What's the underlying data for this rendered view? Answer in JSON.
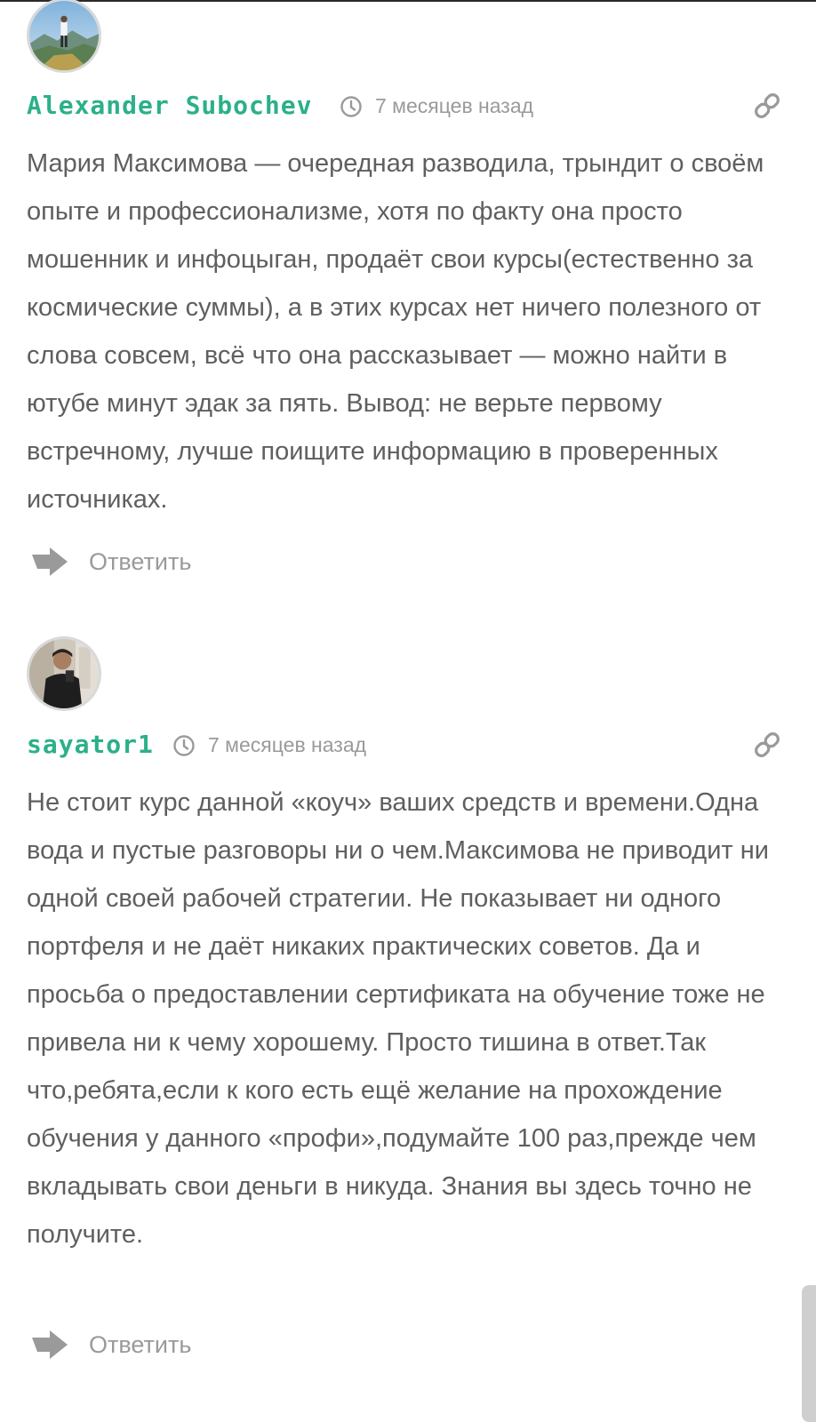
{
  "comments": [
    {
      "author": "Alexander Subochev",
      "time": "7 месяцев назад",
      "text": "Мария Максимова — очередная разводила, трындит о своём опыте и профессионализме, хотя по факту она просто мошенник и инфоцыган, продаёт свои курсы(естественно за космические суммы), а в этих курсах нет ничего полезного от слова совсем, всё что она рассказывает — можно найти в ютубе минут эдак за пять. Вывод: не верьте первому встречному, лучше поищите информацию в проверенных источниках.",
      "reply_label": "Ответить"
    },
    {
      "author": "sayator1",
      "time": "7 месяцев назад",
      "text": "Не стоит курс данной «коуч» ваших средств и времени.Одна вода и пустые разговоры ни о чем.Максимова не приводит ни одной своей рабочей стратегии. Не показывает ни одного портфеля и не даёт никаких практических советов. Да и просьба о предоставлении сертификата на обучение тоже не привела ни к чему хорошему. Просто тишина в ответ.Так что,ребята,если к кого есть ещё желание на прохождение обучения у данного «профи»,подумайте 100 раз,прежде чем вкладывать свои деньги в никуда. Знания вы здесь точно не получите.",
      "reply_label": "Ответить"
    }
  ],
  "colors": {
    "author": "#2bb08a",
    "meta": "#9a9a9a",
    "text": "#5f5f5f",
    "avatar_border": "#d9d9d9"
  },
  "icons": {
    "time": "clock-icon",
    "permalink": "link-icon",
    "reply": "reply-arrow-icon"
  }
}
